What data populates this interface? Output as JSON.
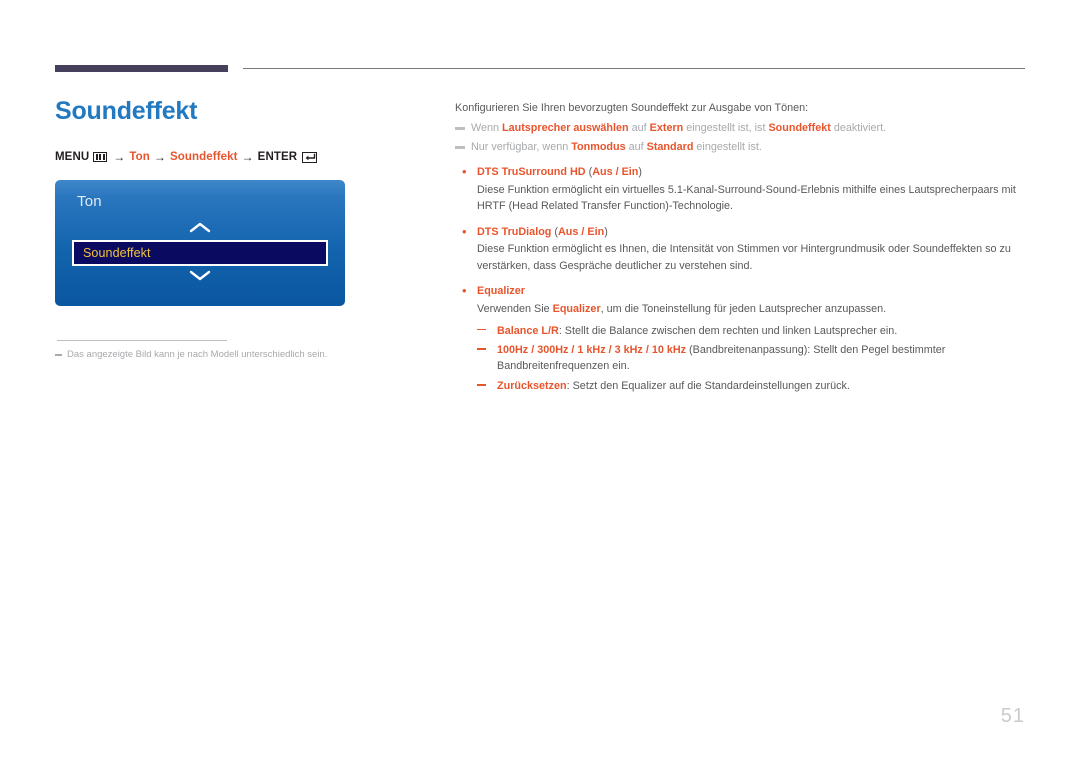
{
  "document": {
    "page_number": "51"
  },
  "left": {
    "title": "Soundeffekt",
    "breadcrumb": {
      "menu_label": "MENU",
      "menu_icon": "menu-grid-icon",
      "arrow": "→",
      "crumb1": "Ton",
      "crumb2": "Soundeffekt",
      "enter_label": "ENTER",
      "enter_icon": "enter-return-icon"
    },
    "osd": {
      "title": "Ton",
      "chevron_up_icon": "chevron-up-icon",
      "chevron_down_icon": "chevron-down-icon",
      "selected_item": "Soundeffekt"
    },
    "footnote": "Das angezeigte Bild kann je nach Modell unterschiedlich sein."
  },
  "right": {
    "intro": "Konfigurieren Sie Ihren bevorzugten Soundeffekt zur Ausgabe von Tönen:",
    "notes": [
      {
        "pre": "Wenn ",
        "b1": "Lautsprecher auswählen",
        "mid1": " auf ",
        "b2": "Extern",
        "mid2": " eingestellt ist, ist ",
        "b3": "Soundeffekt",
        "post": " deaktiviert."
      },
      {
        "pre": "Nur verfügbar, wenn ",
        "b1": "Tonmodus",
        "mid1": " auf ",
        "b2": "Standard",
        "mid2": " eingestellt ist.",
        "b3": "",
        "post": ""
      }
    ],
    "bullets": [
      {
        "bullet": "•",
        "title_bold": "DTS TruSurround HD",
        "title_normal": " (",
        "title_options": "Aus / Ein",
        "title_close": ")",
        "body": "Diese Funktion ermöglicht ein virtuelles 5.1-Kanal-Surround-Sound-Erlebnis mithilfe eines Lautsprecherpaars mit HRTF (Head Related Transfer Function)-Technologie."
      },
      {
        "bullet": "•",
        "title_bold": "DTS TruDialog",
        "title_normal": " (",
        "title_options": "Aus / Ein",
        "title_close": ")",
        "body": "Diese Funktion ermöglicht es Ihnen, die Intensität von Stimmen vor Hintergrundmusik oder Soundeffekten so zu verstärken, dass Gespräche deutlicher zu verstehen sind."
      }
    ],
    "equalizer": {
      "bullet": "•",
      "title": "Equalizer",
      "body_pre": "Verwenden Sie ",
      "body_bold": "Equalizer",
      "body_post": ", um die Toneinstellung für jeden Lautsprecher anzupassen.",
      "sub_items": [
        {
          "bold": "Balance L/R",
          "text": ": Stellt die Balance zwischen dem rechten und linken Lautsprecher ein."
        },
        {
          "bold": "100Hz / 300Hz / 1 kHz / 3 kHz / 10 kHz",
          "text": " (Bandbreitenanpassung): Stellt den Pegel bestimmter Bandbreitenfrequenzen ein."
        },
        {
          "bold": "Zurücksetzen",
          "text": ": Setzt den Equalizer auf die Standardeinstellungen zurück."
        }
      ]
    }
  },
  "colors": {
    "accent_orange": "#e8552d",
    "title_blue": "#2279c0",
    "rule_purple": "#46405c",
    "osd_highlight_bg": "#0a0a60",
    "osd_highlight_text": "#f4c23a"
  }
}
